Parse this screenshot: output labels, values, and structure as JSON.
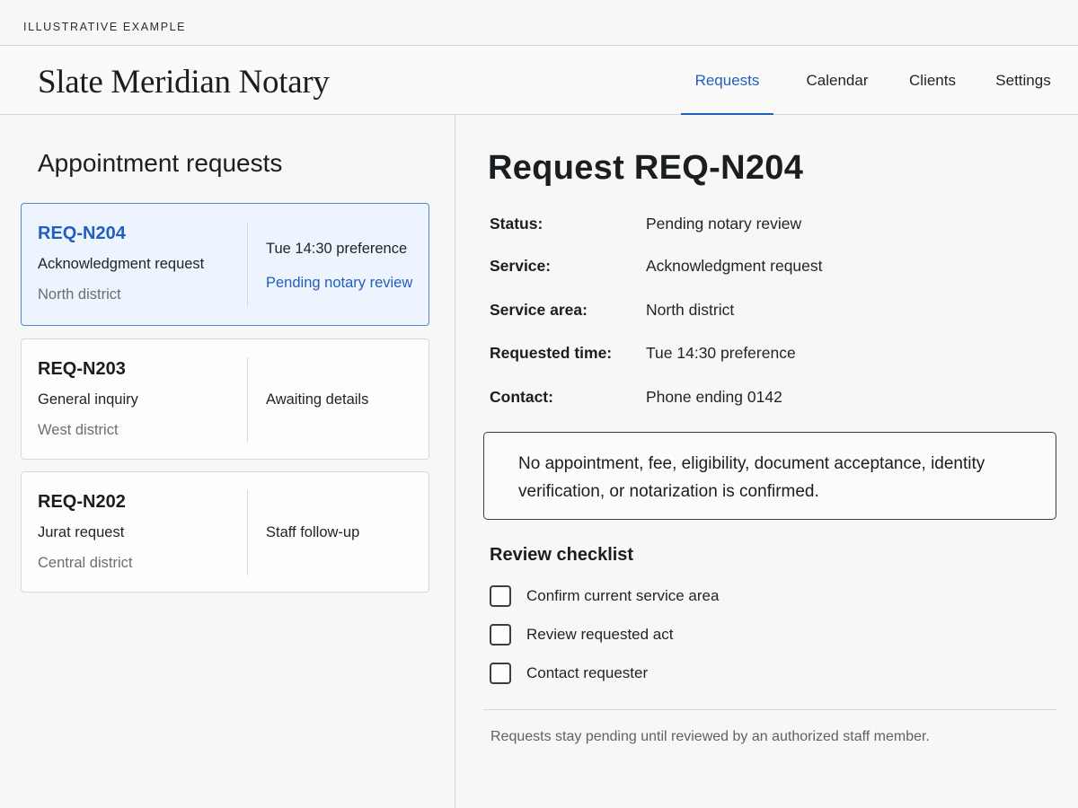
{
  "banner": {
    "text": "ILLUSTRATIVE EXAMPLE"
  },
  "header": {
    "brand": "Slate Meridian Notary",
    "tabs": [
      {
        "label": "Requests",
        "active": true
      },
      {
        "label": "Calendar",
        "active": false
      },
      {
        "label": "Clients",
        "active": false
      },
      {
        "label": "Settings",
        "active": false
      }
    ]
  },
  "sidebar": {
    "title": "Appointment requests",
    "requests": [
      {
        "id": "REQ-N204",
        "service": "Acknowledgment request",
        "area": "North district",
        "time": "Tue 14:30 preference",
        "status": "Pending notary review",
        "selected": true
      },
      {
        "id": "REQ-N203",
        "service": "General inquiry",
        "area": "West district",
        "time": "",
        "status": "Awaiting details",
        "selected": false
      },
      {
        "id": "REQ-N202",
        "service": "Jurat request",
        "area": "Central district",
        "time": "",
        "status": "Staff follow-up",
        "selected": false
      }
    ]
  },
  "detail": {
    "title": "Request REQ-N204",
    "fields": [
      {
        "label": "Status:",
        "value": "Pending notary review"
      },
      {
        "label": "Service:",
        "value": "Acknowledgment request"
      },
      {
        "label": "Service area:",
        "value": "North district"
      },
      {
        "label": "Requested time:",
        "value": "Tue 14:30 preference"
      },
      {
        "label": "Contact:",
        "value": "Phone ending 0142"
      }
    ],
    "notice": "No appointment, fee, eligibility, document acceptance, identity verification, or notarization is confirmed.",
    "checklist_title": "Review checklist",
    "checklist": [
      {
        "label": "Confirm current service area",
        "checked": false
      },
      {
        "label": "Review requested act",
        "checked": false
      },
      {
        "label": "Contact requester",
        "checked": false
      }
    ],
    "footer_note": "Requests stay pending until reviewed by an authorized staff member."
  },
  "colors": {
    "accent": "#1f5fbf",
    "selected_card_bg": "#eef4fd",
    "selected_card_border": "#4d88dc"
  }
}
